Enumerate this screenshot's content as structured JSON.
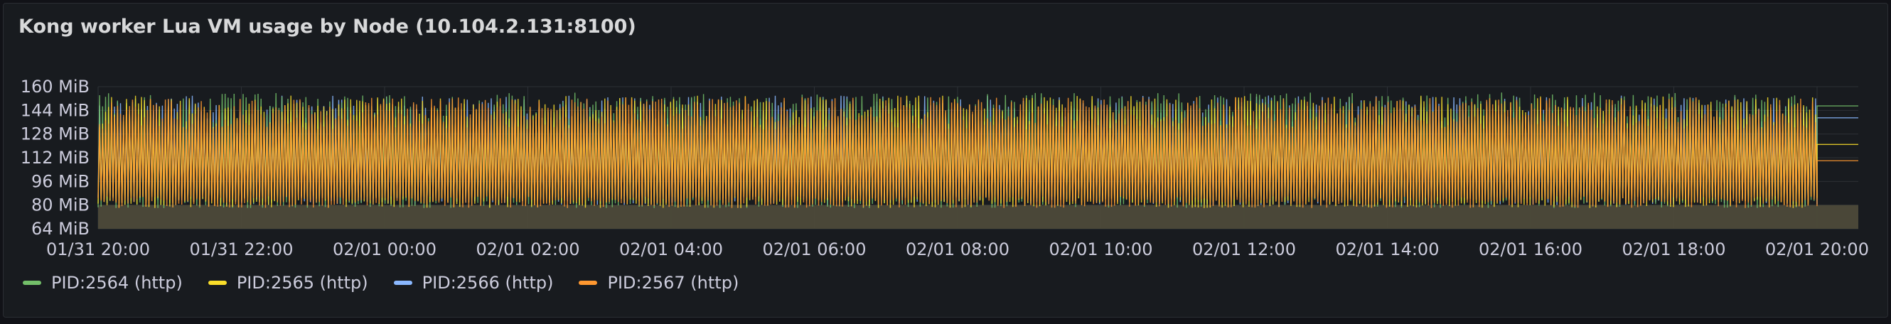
{
  "panel": {
    "title": "Kong worker Lua VM usage by Node (10.104.2.131:8100)"
  },
  "chart_data": {
    "type": "line",
    "title": "Kong worker Lua VM usage by Node (10.104.2.131:8100)",
    "xlabel": "",
    "ylabel": "",
    "y_unit": "MiB",
    "ylim": [
      64,
      160
    ],
    "y_ticks": [
      "64 MiB",
      "80 MiB",
      "96 MiB",
      "112 MiB",
      "128 MiB",
      "144 MiB",
      "160 MiB"
    ],
    "y_tick_values": [
      64,
      80,
      96,
      112,
      128,
      144,
      160
    ],
    "x_range": [
      "01/31 20:00",
      "02/01 20:00"
    ],
    "x_ticks": [
      "01/31 20:00",
      "01/31 22:00",
      "02/01 00:00",
      "02/01 02:00",
      "02/01 04:00",
      "02/01 06:00",
      "02/01 08:00",
      "02/01 10:00",
      "02/01 12:00",
      "02/01 14:00",
      "02/01 16:00",
      "02/01 18:00",
      "02/01 20:00"
    ],
    "fill_baseline": 64,
    "fill_level": 80,
    "grid": true,
    "legend_position": "bottom-left",
    "series": [
      {
        "name": "PID:2564 (http)",
        "color": "#73bf69",
        "min": 78,
        "max": 156,
        "final": 147
      },
      {
        "name": "PID:2565 (http)",
        "color": "#fade2a",
        "min": 78,
        "max": 154,
        "final": 121
      },
      {
        "name": "PID:2566 (http)",
        "color": "#8ab8ff",
        "min": 80,
        "max": 154,
        "final": 139
      },
      {
        "name": "PID:2567 (http)",
        "color": "#ff9830",
        "min": 78,
        "max": 153,
        "final": 110
      }
    ]
  }
}
